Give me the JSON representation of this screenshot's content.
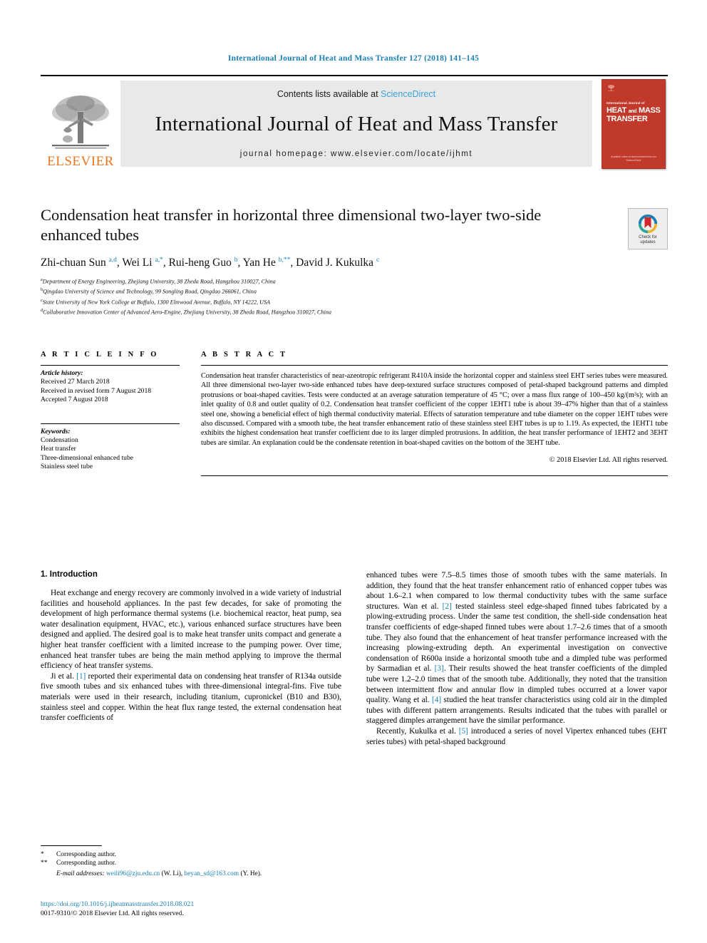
{
  "running_head": "International Journal of Heat and Mass Transfer 127 (2018) 141–145",
  "masthead": {
    "publisher": "ELSEVIER",
    "contents_prefix": "Contents lists available at ",
    "sciencedirect": "ScienceDirect",
    "journal_title": "International Journal of Heat and Mass Transfer",
    "homepage": "journal homepage: www.elsevier.com/locate/ijhmt",
    "cover": {
      "sub": "International Journal of",
      "line1": "HEAT",
      "and": "and",
      "line1b": "MASS",
      "line2": "TRANSFER",
      "footer_a": "Available online at www.sciencedirect.com",
      "footer_b": "ScienceDirect"
    },
    "accent_blue": "#1a7fb5",
    "elsevier_orange": "#e87722",
    "cover_red": "#c0392b"
  },
  "article": {
    "title": "Condensation heat transfer in horizontal three dimensional two-layer two-side enhanced tubes",
    "crossmark_label_line1": "Check for",
    "crossmark_label_line2": "updates",
    "authors_html": "Zhi-chuan Sun <sup>a,d</sup>, Wei Li <sup>a,*</sup>, Rui-heng Guo <sup>b</sup>, Yan He <sup>b,**</sup>, David J. Kukulka <sup>c</sup>",
    "affiliations": [
      {
        "mark": "a",
        "text": "Department of Energy Engineering, Zhejiang University, 38 Zheda Road, Hangzhou 310027, China"
      },
      {
        "mark": "b",
        "text": "Qingdao University of Science and Technology, 99 Songling Road, Qingdao 266061, China"
      },
      {
        "mark": "c",
        "text": "State University of New York College at Buffalo, 1300 Elmwood Avenue, Buffalo, NY 14222, USA"
      },
      {
        "mark": "d",
        "text": "Collaborative Innovation Center of Advanced Aero-Engine, Zhejiang University, 38 Zheda Road, Hangzhou 310027, China"
      }
    ]
  },
  "article_info": {
    "heading": "A R T I C L E   I N F O",
    "history_label": "Article history:",
    "history": [
      "Received 27 March 2018",
      "Received in revised form 7 August 2018",
      "Accepted 7 August 2018"
    ],
    "keywords_label": "Keywords:",
    "keywords": [
      "Condensation",
      "Heat transfer",
      "Three-dimensional enhanced tube",
      "Stainless steel tube"
    ]
  },
  "abstract": {
    "heading": "A B S T R A C T",
    "text": "Condensation heat transfer characteristics of near-azeotropic refrigerant R410A inside the horizontal copper and stainless steel EHT series tubes were measured. All three dimensional two-layer two-side enhanced tubes have deep-textured surface structures composed of petal-shaped background patterns and dimpled protrusions or boat-shaped cavities. Tests were conducted at an average saturation temperature of 45 °C; over a mass flux range of 100–450 kg/(m²s); with an inlet quality of 0.8 and outlet quality of 0.2. Condensation heat transfer coefficient of the copper 1EHT1 tube is about 39–47% higher than that of a stainless steel one, showing a beneficial effect of high thermal conductivity material. Effects of saturation temperature and tube diameter on the copper 1EHT tubes were also discussed. Compared with a smooth tube, the heat transfer enhancement ratio of these stainless steel EHT tubes is up to 1.19. As expected, the 1EHT1 tube exhibits the highest condensation heat transfer coefficient due to its larger dimpled protrusions. In addition, the heat transfer performance of 1EHT2 and 3EHT tubes are similar. An explanation could be the condensate retention in boat-shaped cavities on the bottom of the 3EHT tube.",
    "copyright": "© 2018 Elsevier Ltd. All rights reserved."
  },
  "section": {
    "heading": "1. Introduction",
    "left_paragraphs": [
      "Heat exchange and energy recovery are commonly involved in a wide variety of industrial facilities and household appliances. In the past few decades, for sake of promoting the development of high performance thermal systems (i.e. biochemical reactor, heat pump, sea water desalination equipment, HVAC, etc.), various enhanced surface structures have been designed and applied. The desired goal is to make heat transfer units compact and generate a higher heat transfer coefficient with a limited increase to the pumping power. Over time, enhanced heat transfer tubes are being the main method applying to improve the thermal efficiency of heat transfer systems.",
      "Ji et al. [1] reported their experimental data on condensing heat transfer of R134a outside five smooth tubes and six enhanced tubes with three-dimensional integral-fins. Five tube materials were used in their research, including titanium, cupronickel (B10 and B30), stainless steel and copper. Within the heat flux range tested, the external condensation heat transfer coefficients of"
    ],
    "right_paragraphs": [
      "enhanced tubes were 7.5–8.5 times those of smooth tubes with the same materials. In addition, they found that the heat transfer enhancement ratio of enhanced copper tubes was about 1.6–2.1 when compared to low thermal conductivity tubes with the same surface structures. Wan et al. [2] tested stainless steel edge-shaped finned tubes fabricated by a plowing-extruding process. Under the same test condition, the shell-side condensation heat transfer coefficients of edge-shaped finned tubes were about 1.7–2.6 times that of a smooth tube. They also found that the enhancement of heat transfer performance increased with the increasing plowing-extruding depth. An experimental investigation on convective condensation of R600a inside a horizontal smooth tube and a dimpled tube was performed by Sarmadian et al. [3]. Their results showed the heat transfer coefficients of the dimpled tube were 1.2–2.0 times that of the smooth tube. Additionally, they noted that the transition between intermittent flow and annular flow in dimpled tubes occurred at a lower vapor quality. Wang et al. [4] studied the heat transfer characteristics using cold air in the dimpled tubes with different pattern arrangements. Results indicated that the tubes with parallel or staggered dimples arrangement have the similar performance.",
      "Recently, Kukulka et al. [5] introduced a series of novel Vipertex enhanced tubes (EHT series tubes) with petal-shaped background"
    ]
  },
  "footnotes": {
    "star1_mark": "*",
    "star1_text": "Corresponding author.",
    "star2_mark": "**",
    "star2_text": "Corresponding author.",
    "email_label": "E-mail addresses:",
    "email1": "weili96@zju.edu.cn",
    "email1_who": "(W. Li)",
    "email2": "heyan_sd@163.com",
    "email2_who": "(Y. He).",
    "doi": "https://doi.org/10.1016/j.ijheatmasstransfer.2018.08.021",
    "issn": "0017-9310/© 2018 Elsevier Ltd. All rights reserved."
  }
}
